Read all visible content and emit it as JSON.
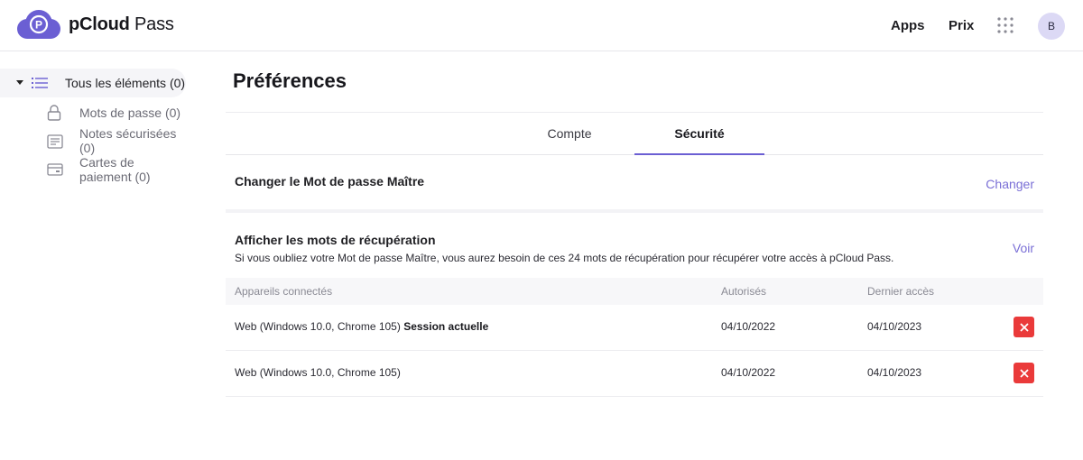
{
  "app": {
    "brand_bold": "pCloud",
    "brand_regular": "Pass",
    "logo_letter": "P",
    "accent_color": "#6b5fd3"
  },
  "header": {
    "apps_label": "Apps",
    "price_label": "Prix",
    "avatar_initial": "B"
  },
  "sidebar": {
    "all_items": "Tous les éléments (0)",
    "items": [
      {
        "label": "Mots de passe (0)",
        "icon": "lock-icon"
      },
      {
        "label": "Notes sécurisées (0)",
        "icon": "note-icon"
      },
      {
        "label": "Cartes de paiement (0)",
        "icon": "card-icon"
      }
    ]
  },
  "page": {
    "title": "Préférences",
    "tabs": [
      {
        "label": "Compte",
        "active": false
      },
      {
        "label": "Sécurité",
        "active": true
      }
    ]
  },
  "security": {
    "change_master": {
      "title": "Changer le Mot de passe Maître",
      "action": "Changer"
    },
    "recovery": {
      "title": "Afficher les mots de récupération",
      "description": "Si vous oubliez votre Mot de passe Maître, vous aurez besoin de ces 24 mots de récupération pour récupérer votre accès à pCloud Pass.",
      "action": "Voir"
    },
    "devices": {
      "columns": [
        "Appareils connectés",
        "Autorisés",
        "Dernier accès"
      ],
      "rows": [
        {
          "device": "Web (Windows 10.0, Chrome 105)",
          "current_label": "Session actuelle",
          "authorized": "04/10/2022",
          "last_access": "04/10/2023"
        },
        {
          "device": "Web (Windows 10.0, Chrome 105)",
          "current_label": "",
          "authorized": "04/10/2022",
          "last_access": "04/10/2023"
        }
      ],
      "delete_color": "#ea3a3a"
    }
  }
}
